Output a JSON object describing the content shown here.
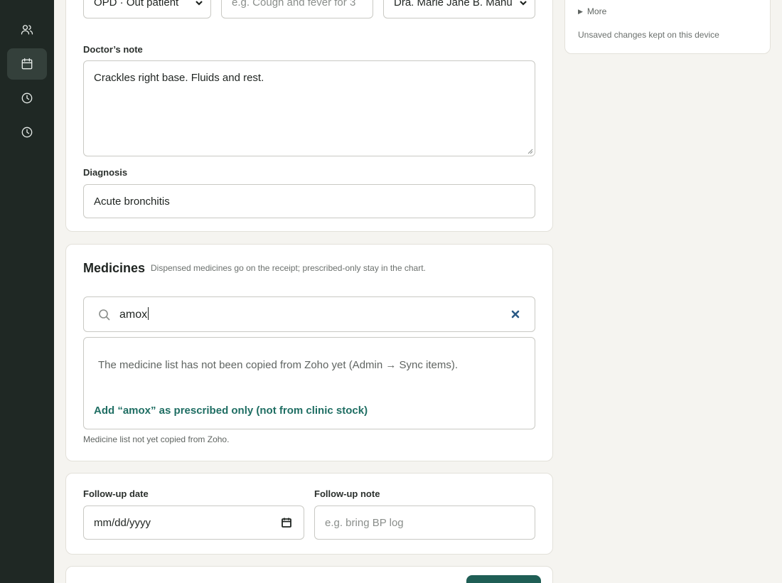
{
  "sidebar": {
    "items": [
      {
        "icon": "users-icon",
        "active": false
      },
      {
        "icon": "calendar-icon",
        "active": true
      },
      {
        "icon": "clock-icon",
        "active": false
      },
      {
        "icon": "history-icon",
        "active": false
      }
    ]
  },
  "visit": {
    "type_value": "OPD · Out patient",
    "complaint_placeholder": "e.g. Cough and fever for 3",
    "doctor_value": "Dra. Marie Jane B. Manu",
    "doctor_note_label": "Doctor’s note",
    "doctor_note_value": "Crackles right base. Fluids and rest.",
    "diagnosis_label": "Diagnosis",
    "diagnosis_value": "Acute bronchitis"
  },
  "medicines": {
    "title": "Medicines",
    "subtitle": "Dispensed medicines go on the receipt; prescribed-only stay in the chart.",
    "search_value": "amox",
    "empty_message": "The medicine list has not been copied from Zoho yet (Admin → Sync items).",
    "add_prescribed_label": "Add “amox” as prescribed only (not from clinic stock)",
    "hint": "Medicine list not yet copied from Zoho."
  },
  "followup": {
    "date_label": "Follow-up date",
    "date_placeholder": "mm/dd/yyyy",
    "note_label": "Follow-up note",
    "note_placeholder": "e.g. bring BP log"
  },
  "side_panel": {
    "more_label": "More",
    "unsaved_note": "Unsaved changes kept on this device"
  },
  "colors": {
    "sidebar_bg": "#1f2824",
    "accent": "#1f6e63",
    "primary_button": "#1f5e55"
  }
}
